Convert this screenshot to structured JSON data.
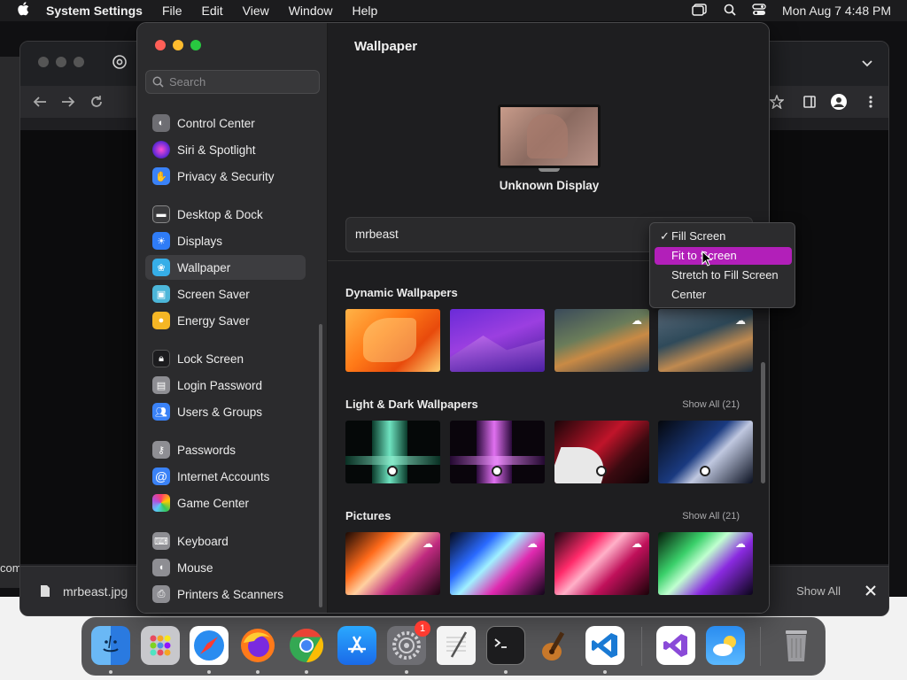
{
  "menubar": {
    "app_name": "System Settings",
    "menus": [
      "File",
      "Edit",
      "View",
      "Window",
      "Help"
    ],
    "clock": "Mon Aug 7  4:48 PM"
  },
  "browser": {
    "download_filename": "mrbeast.jpg",
    "show_all_label": "Show All",
    "left_edge_text": "com"
  },
  "sidebar": {
    "search_placeholder": "Search",
    "items": [
      {
        "label": "Control Center",
        "icon": "control-center-icon",
        "color": "#6e6e73"
      },
      {
        "label": "Siri & Spotlight",
        "icon": "siri-icon",
        "color": "#b43bd1"
      },
      {
        "label": "Privacy & Security",
        "icon": "hand-icon",
        "color": "#3a82f7"
      },
      {
        "label": "Desktop & Dock",
        "icon": "dock-icon",
        "color": "#3a3a3c"
      },
      {
        "label": "Displays",
        "icon": "sun-icon",
        "color": "#2f7cf6"
      },
      {
        "label": "Wallpaper",
        "icon": "flower-icon",
        "color": "#36aee8"
      },
      {
        "label": "Screen Saver",
        "icon": "screen-saver-icon",
        "color": "#4cb6d9"
      },
      {
        "label": "Energy Saver",
        "icon": "bulb-icon",
        "color": "#f5b625"
      },
      {
        "label": "Lock Screen",
        "icon": "lock-icon",
        "color": "#1c1c1e"
      },
      {
        "label": "Login Password",
        "icon": "padlock-icon",
        "color": "#8e8e93"
      },
      {
        "label": "Users & Groups",
        "icon": "users-icon",
        "color": "#3a82f7"
      },
      {
        "label": "Passwords",
        "icon": "key-icon",
        "color": "#8e8e93"
      },
      {
        "label": "Internet Accounts",
        "icon": "at-icon",
        "color": "#3a82f7"
      },
      {
        "label": "Game Center",
        "icon": "game-center-icon",
        "color": "#e9e9ee"
      },
      {
        "label": "Keyboard",
        "icon": "keyboard-icon",
        "color": "#8e8e93"
      },
      {
        "label": "Mouse",
        "icon": "mouse-icon",
        "color": "#8e8e93"
      },
      {
        "label": "Printers & Scanners",
        "icon": "printer-icon",
        "color": "#8e8e93"
      }
    ],
    "selected": "Wallpaper"
  },
  "pane": {
    "title": "Wallpaper",
    "display_name": "Unknown Display",
    "current_wallpaper": "mrbeast",
    "sections": [
      {
        "title": "Dynamic Wallpapers",
        "show_all": ""
      },
      {
        "title": "Light & Dark Wallpapers",
        "show_all": "Show All (21)"
      },
      {
        "title": "Pictures",
        "show_all": "Show All (21)"
      }
    ]
  },
  "dropdown": {
    "options": [
      "Fill Screen",
      "Fit to Screen",
      "Stretch to Fill Screen",
      "Center"
    ],
    "checked": "Fill Screen",
    "highlighted": "Fit to Screen",
    "highlight_color": "#b21fb9"
  },
  "dock": {
    "apps": [
      "Finder",
      "Launchpad",
      "Safari",
      "Firefox",
      "Chrome",
      "App Store",
      "System Settings",
      "TextEdit",
      "Terminal",
      "GarageBand",
      "Visual Studio Code",
      "Visual Studio",
      "Weather",
      "Trash"
    ],
    "settings_badge": "1"
  }
}
